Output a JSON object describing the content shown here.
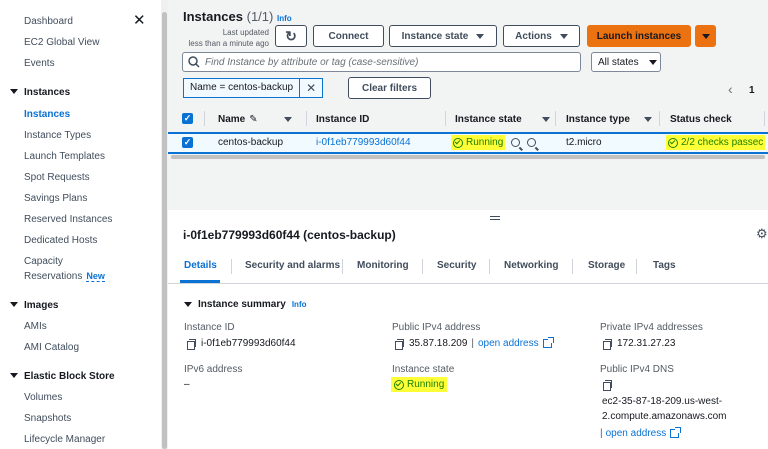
{
  "sidebar": {
    "items": [
      {
        "label": "Dashboard"
      },
      {
        "label": "EC2 Global View"
      },
      {
        "label": "Events"
      }
    ],
    "sections": [
      {
        "label": "Instances",
        "items": [
          "Instances",
          "Instance Types",
          "Launch Templates",
          "Spot Requests",
          "Savings Plans",
          "Reserved Instances",
          "Dedicated Hosts",
          "Capacity",
          "Reservations"
        ]
      },
      {
        "label": "Images",
        "items": [
          "AMIs",
          "AMI Catalog"
        ]
      },
      {
        "label": "Elastic Block Store",
        "items": [
          "Volumes",
          "Snapshots",
          "Lifecycle Manager"
        ]
      }
    ],
    "new_badge": "New",
    "close_glyph": "✕"
  },
  "header": {
    "title": "Instances",
    "count": "(1/1)",
    "info": "Info",
    "last_updated_1": "Last updated",
    "last_updated_2": "less than a minute ago",
    "refresh_glyph": "↻",
    "connect": "Connect",
    "instance_state": "Instance state",
    "actions": "Actions",
    "launch": "Launch instances"
  },
  "filter": {
    "placeholder": "Find Instance by attribute or tag (case-sensitive)",
    "states": "All states",
    "token": "Name = centos-backup",
    "token_close": "✕",
    "clear": "Clear filters",
    "page_prev": "‹",
    "page": "1"
  },
  "table": {
    "columns": [
      "Name",
      "Instance ID",
      "Instance state",
      "Instance type",
      "Status check"
    ],
    "row": {
      "name": "centos-backup",
      "id": "i-0f1eb779993d60f44",
      "state": "Running",
      "type": "t2.micro",
      "status": "2/2 checks passec"
    },
    "pencil_glyph": "✎"
  },
  "details": {
    "title": "i-0f1eb779993d60f44 (centos-backup)",
    "gear_glyph": "⚙",
    "tabs": [
      "Details",
      "Security and alarms",
      "Monitoring",
      "Security",
      "Networking",
      "Storage",
      "Tags"
    ],
    "summary": "Instance summary",
    "info": "Info",
    "instance_id_label": "Instance ID",
    "instance_id": "i-0f1eb779993d60f44",
    "ipv6_label": "IPv6 address",
    "ipv6": "–",
    "public_ipv4_label": "Public IPv4 address",
    "public_ipv4": "35.87.18.209",
    "open_address": "open address",
    "sep": "|",
    "state_label": "Instance state",
    "state": "Running",
    "private_ipv4_label": "Private IPv4 addresses",
    "private_ipv4": "172.31.27.23",
    "dns_label": "Public IPv4 DNS",
    "dns_1": "ec2-35-87-18-209.us-west-",
    "dns_2": "2.compute.amazonaws.com"
  },
  "colors": {
    "accent": "#0972d3",
    "primary": "#ec7211",
    "success": "#1d8102",
    "highlight": "#ffff38"
  }
}
